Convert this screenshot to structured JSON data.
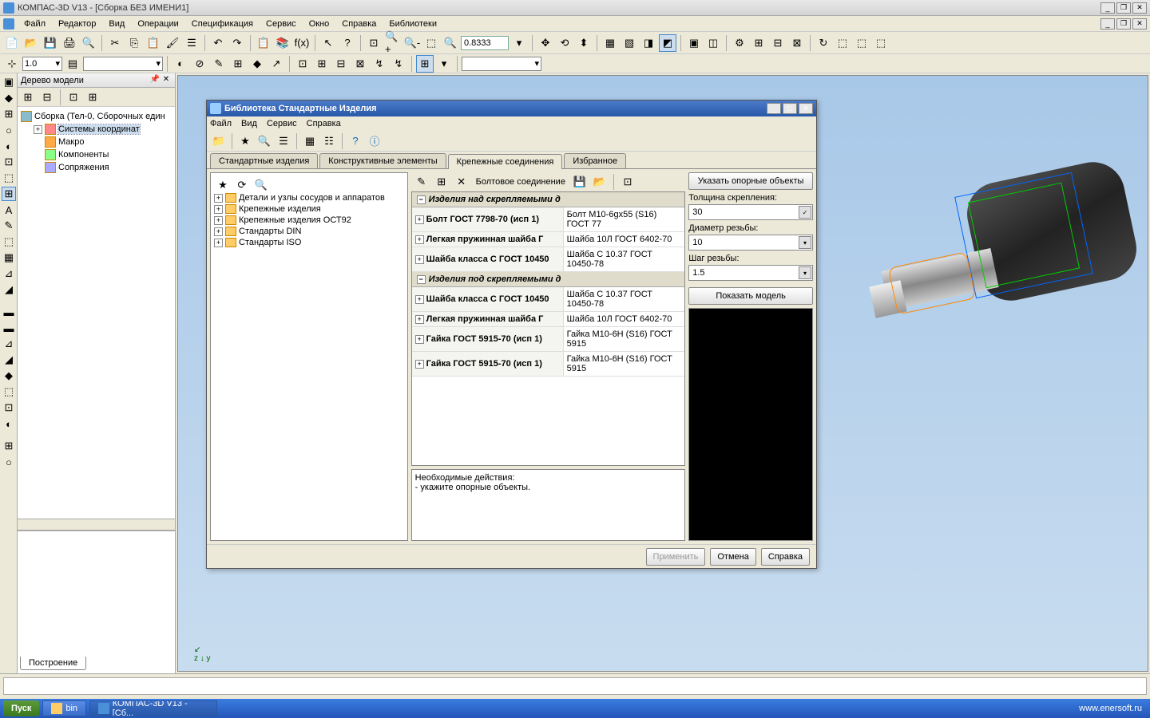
{
  "app": {
    "title": "КОМПАС-3D V13 - [Сборка БЕЗ ИМЕНИ1]"
  },
  "mainmenu": {
    "items": [
      "Файл",
      "Редактор",
      "Вид",
      "Операции",
      "Спецификация",
      "Сервис",
      "Окно",
      "Справка",
      "Библиотеки"
    ]
  },
  "toolbar": {
    "zoom": "0.8333"
  },
  "toolbar2": {
    "scale": "1.0"
  },
  "tree": {
    "title": "Дерево модели",
    "root": "Сборка (Тел-0, Сборочных един",
    "nodes": [
      "Системы координат",
      "Макро",
      "Компоненты",
      "Сопряжения"
    ]
  },
  "bottom_tab": "Построение",
  "dialog": {
    "title": "Библиотека Стандартные Изделия",
    "menu": [
      "Файл",
      "Вид",
      "Сервис",
      "Справка"
    ],
    "tabs": [
      "Стандартные изделия",
      "Конструктивные элементы",
      "Крепежные соединения",
      "Избранное"
    ],
    "active_tab": 2,
    "folders": [
      "Детали и узлы сосудов и аппаратов",
      "Крепежные изделия",
      "Крепежные изделия ОСТ92",
      "Стандарты DIN",
      "Стандарты ISO"
    ],
    "mid_toolbar_label": "Болтовое соединение",
    "grid": {
      "section1": "Изделия над скрепляемыми д",
      "rows1": [
        {
          "c1": "Болт ГОСТ 7798-70 (исп 1)",
          "c2": "Болт М10-6gx55 (S16) ГОСТ 77"
        },
        {
          "c1": "Легкая пружинная шайба Г",
          "c2": "Шайба 10Л ГОСТ 6402-70"
        },
        {
          "c1": "Шайба класса С ГОСТ 10450",
          "c2": "Шайба С 10.37 ГОСТ 10450-78"
        }
      ],
      "section2": "Изделия под скрепляемыми д",
      "rows2": [
        {
          "c1": "Шайба класса С ГОСТ 10450",
          "c2": "Шайба С 10.37 ГОСТ 10450-78"
        },
        {
          "c1": "Легкая пружинная шайба Г",
          "c2": "Шайба 10Л ГОСТ 6402-70"
        },
        {
          "c1": "Гайка ГОСТ 5915-70 (исп 1)",
          "c2": "Гайка М10-6H (S16) ГОСТ 5915"
        },
        {
          "c1": "Гайка ГОСТ 5915-70 (исп 1)",
          "c2": "Гайка М10-6H (S16) ГОСТ 5915"
        }
      ]
    },
    "msg": {
      "l1": "Необходимые действия:",
      "l2": "- укажите опорные объекты."
    },
    "right": {
      "btn_ref": "Указать опорные объекты",
      "lbl_thick": "Толщина скрепления:",
      "val_thick": "30",
      "lbl_diam": "Диаметр резьбы:",
      "val_diam": "10",
      "lbl_pitch": "Шаг резьбы:",
      "val_pitch": "1.5",
      "btn_show": "Показать модель"
    },
    "footer": {
      "apply": "Применить",
      "cancel": "Отмена",
      "help": "Справка"
    }
  },
  "taskbar": {
    "start": "Пуск",
    "items": [
      {
        "label": "bin"
      },
      {
        "label": "КОМПАС-3D V13 - [Сб..."
      }
    ],
    "watermark": "www.enersoft.ru"
  }
}
